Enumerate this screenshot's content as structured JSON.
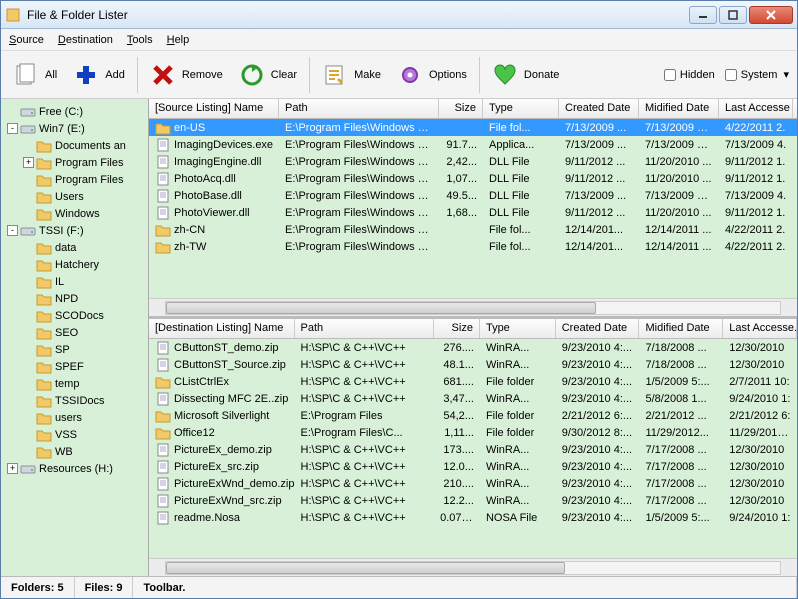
{
  "window": {
    "title": "File & Folder Lister"
  },
  "menu": {
    "source": "Source",
    "destination": "Destination",
    "tools": "Tools",
    "help": "Help"
  },
  "toolbar": {
    "all": "All",
    "add": "Add",
    "remove": "Remove",
    "clear": "Clear",
    "make": "Make",
    "options": "Options",
    "donate": "Donate",
    "hidden": "Hidden",
    "system": "System"
  },
  "tree": [
    {
      "depth": 0,
      "tog": "",
      "icon": "drive",
      "label": "Free (C:)"
    },
    {
      "depth": 0,
      "tog": "-",
      "icon": "drive",
      "label": "Win7 (E:)"
    },
    {
      "depth": 1,
      "tog": "",
      "icon": "folder",
      "label": "Documents an"
    },
    {
      "depth": 1,
      "tog": "+",
      "icon": "folder",
      "label": "Program Files"
    },
    {
      "depth": 1,
      "tog": "",
      "icon": "folder",
      "label": "Program Files"
    },
    {
      "depth": 1,
      "tog": "",
      "icon": "folder",
      "label": "Users"
    },
    {
      "depth": 1,
      "tog": "",
      "icon": "folder",
      "label": "Windows"
    },
    {
      "depth": 0,
      "tog": "-",
      "icon": "drive",
      "label": "TSSI (F:)"
    },
    {
      "depth": 1,
      "tog": "",
      "icon": "folder",
      "label": "data"
    },
    {
      "depth": 1,
      "tog": "",
      "icon": "folder",
      "label": "Hatchery"
    },
    {
      "depth": 1,
      "tog": "",
      "icon": "folder",
      "label": "IL"
    },
    {
      "depth": 1,
      "tog": "",
      "icon": "folder",
      "label": "NPD"
    },
    {
      "depth": 1,
      "tog": "",
      "icon": "folder",
      "label": "SCODocs"
    },
    {
      "depth": 1,
      "tog": "",
      "icon": "folder",
      "label": "SEO"
    },
    {
      "depth": 1,
      "tog": "",
      "icon": "folder",
      "label": "SP"
    },
    {
      "depth": 1,
      "tog": "",
      "icon": "folder",
      "label": "SPEF"
    },
    {
      "depth": 1,
      "tog": "",
      "icon": "folder",
      "label": "temp"
    },
    {
      "depth": 1,
      "tog": "",
      "icon": "folder",
      "label": "TSSIDocs"
    },
    {
      "depth": 1,
      "tog": "",
      "icon": "folder",
      "label": "users"
    },
    {
      "depth": 1,
      "tog": "",
      "icon": "folder",
      "label": "VSS"
    },
    {
      "depth": 1,
      "tog": "",
      "icon": "folder",
      "label": "WB"
    },
    {
      "depth": 0,
      "tog": "+",
      "icon": "drive",
      "label": "Resources (H:)"
    }
  ],
  "source": {
    "headers": [
      "[Source Listing] Name",
      "Path",
      "Size",
      "Type",
      "Created Date",
      "Midified Date",
      "Last Accesse"
    ],
    "rows": [
      {
        "sel": true,
        "icon": "folder",
        "name": "en-US",
        "path": "E:\\Program Files\\Windows Pho...",
        "size": "",
        "type": "File fol...",
        "cd": "7/13/2009 ...",
        "md": "7/13/2009 9:...",
        "la": "4/22/2011 2."
      },
      {
        "icon": "file",
        "name": "ImagingDevices.exe",
        "path": "E:\\Program Files\\Windows Pho...",
        "size": "91.7...",
        "type": "Applica...",
        "cd": "7/13/2009 ...",
        "md": "7/13/2009 5:...",
        "la": "7/13/2009 4."
      },
      {
        "icon": "file",
        "name": "ImagingEngine.dll",
        "path": "E:\\Program Files\\Windows Pho...",
        "size": "2,42...",
        "type": "DLL File",
        "cd": "9/11/2012 ...",
        "md": "11/20/2010 ...",
        "la": "9/11/2012 1."
      },
      {
        "icon": "file",
        "name": "PhotoAcq.dll",
        "path": "E:\\Program Files\\Windows Pho...",
        "size": "1,07...",
        "type": "DLL File",
        "cd": "9/11/2012 ...",
        "md": "11/20/2010 ...",
        "la": "9/11/2012 1."
      },
      {
        "icon": "file",
        "name": "PhotoBase.dll",
        "path": "E:\\Program Files\\Windows Pho...",
        "size": "49.5...",
        "type": "DLL File",
        "cd": "7/13/2009 ...",
        "md": "7/13/2009 5:...",
        "la": "7/13/2009 4."
      },
      {
        "icon": "file",
        "name": "PhotoViewer.dll",
        "path": "E:\\Program Files\\Windows Pho...",
        "size": "1,68...",
        "type": "DLL File",
        "cd": "9/11/2012 ...",
        "md": "11/20/2010 ...",
        "la": "9/11/2012 1."
      },
      {
        "icon": "folder",
        "name": "zh-CN",
        "path": "E:\\Program Files\\Windows Pho...",
        "size": "",
        "type": "File fol...",
        "cd": "12/14/201...",
        "md": "12/14/2011 ...",
        "la": "4/22/2011 2."
      },
      {
        "icon": "folder",
        "name": "zh-TW",
        "path": "E:\\Program Files\\Windows Pho...",
        "size": "",
        "type": "File fol...",
        "cd": "12/14/201...",
        "md": "12/14/2011 ...",
        "la": "4/22/2011 2."
      }
    ]
  },
  "dest": {
    "headers": [
      "[Destination Listing] Name",
      "Path",
      "Size",
      "Type",
      "Created Date",
      "Midified Date",
      "Last Accesse."
    ],
    "rows": [
      {
        "icon": "file",
        "name": "CButtonST_demo.zip",
        "path": "H:\\SP\\C & C++\\VC++",
        "size": "276....",
        "type": "WinRA...",
        "cd": "9/23/2010 4:...",
        "md": "7/18/2008 ...",
        "la": "12/30/2010"
      },
      {
        "icon": "file",
        "name": "CButtonST_Source.zip",
        "path": "H:\\SP\\C & C++\\VC++",
        "size": "48.1...",
        "type": "WinRA...",
        "cd": "9/23/2010 4:...",
        "md": "7/18/2008 ...",
        "la": "12/30/2010"
      },
      {
        "icon": "folder",
        "name": "CListCtrlEx",
        "path": "H:\\SP\\C & C++\\VC++",
        "size": "681....",
        "type": "File folder",
        "cd": "9/23/2010 4:...",
        "md": "1/5/2009 5:...",
        "la": "2/7/2011 10:"
      },
      {
        "icon": "file",
        "name": "Dissecting MFC 2E..zip",
        "path": "H:\\SP\\C & C++\\VC++",
        "size": "3,47...",
        "type": "WinRA...",
        "cd": "9/23/2010 4:...",
        "md": "5/8/2008 1...",
        "la": "9/24/2010 1:"
      },
      {
        "icon": "folder",
        "name": "Microsoft Silverlight",
        "path": "E:\\Program Files",
        "size": "54,2...",
        "type": "File folder",
        "cd": "2/21/2012 6:...",
        "md": "2/21/2012 ...",
        "la": "2/21/2012 6:"
      },
      {
        "icon": "folder",
        "name": "Office12",
        "path": "E:\\Program Files\\C...",
        "size": "1,11...",
        "type": "File folder",
        "cd": "9/30/2012 8:...",
        "md": "11/29/2012...",
        "la": "11/29/2012 1"
      },
      {
        "icon": "file",
        "name": "PictureEx_demo.zip",
        "path": "H:\\SP\\C & C++\\VC++",
        "size": "173....",
        "type": "WinRA...",
        "cd": "9/23/2010 4:...",
        "md": "7/17/2008 ...",
        "la": "12/30/2010"
      },
      {
        "icon": "file",
        "name": "PictureEx_src.zip",
        "path": "H:\\SP\\C & C++\\VC++",
        "size": "12.0...",
        "type": "WinRA...",
        "cd": "9/23/2010 4:...",
        "md": "7/17/2008 ...",
        "la": "12/30/2010"
      },
      {
        "icon": "file",
        "name": "PictureExWnd_demo.zip",
        "path": "H:\\SP\\C & C++\\VC++",
        "size": "210....",
        "type": "WinRA...",
        "cd": "9/23/2010 4:...",
        "md": "7/17/2008 ...",
        "la": "12/30/2010"
      },
      {
        "icon": "file",
        "name": "PictureExWnd_src.zip",
        "path": "H:\\SP\\C & C++\\VC++",
        "size": "12.2...",
        "type": "WinRA...",
        "cd": "9/23/2010 4:...",
        "md": "7/17/2008 ...",
        "la": "12/30/2010"
      },
      {
        "icon": "file",
        "name": "readme.Nosa",
        "path": "H:\\SP\\C & C++\\VC++",
        "size": "0.07 KB",
        "type": "NOSA File",
        "cd": "9/23/2010 4:...",
        "md": "1/5/2009 5:...",
        "la": "9/24/2010 1:"
      }
    ]
  },
  "status": {
    "folders": "Folders: 5",
    "files": "Files: 9",
    "toolbar": "Toolbar."
  }
}
